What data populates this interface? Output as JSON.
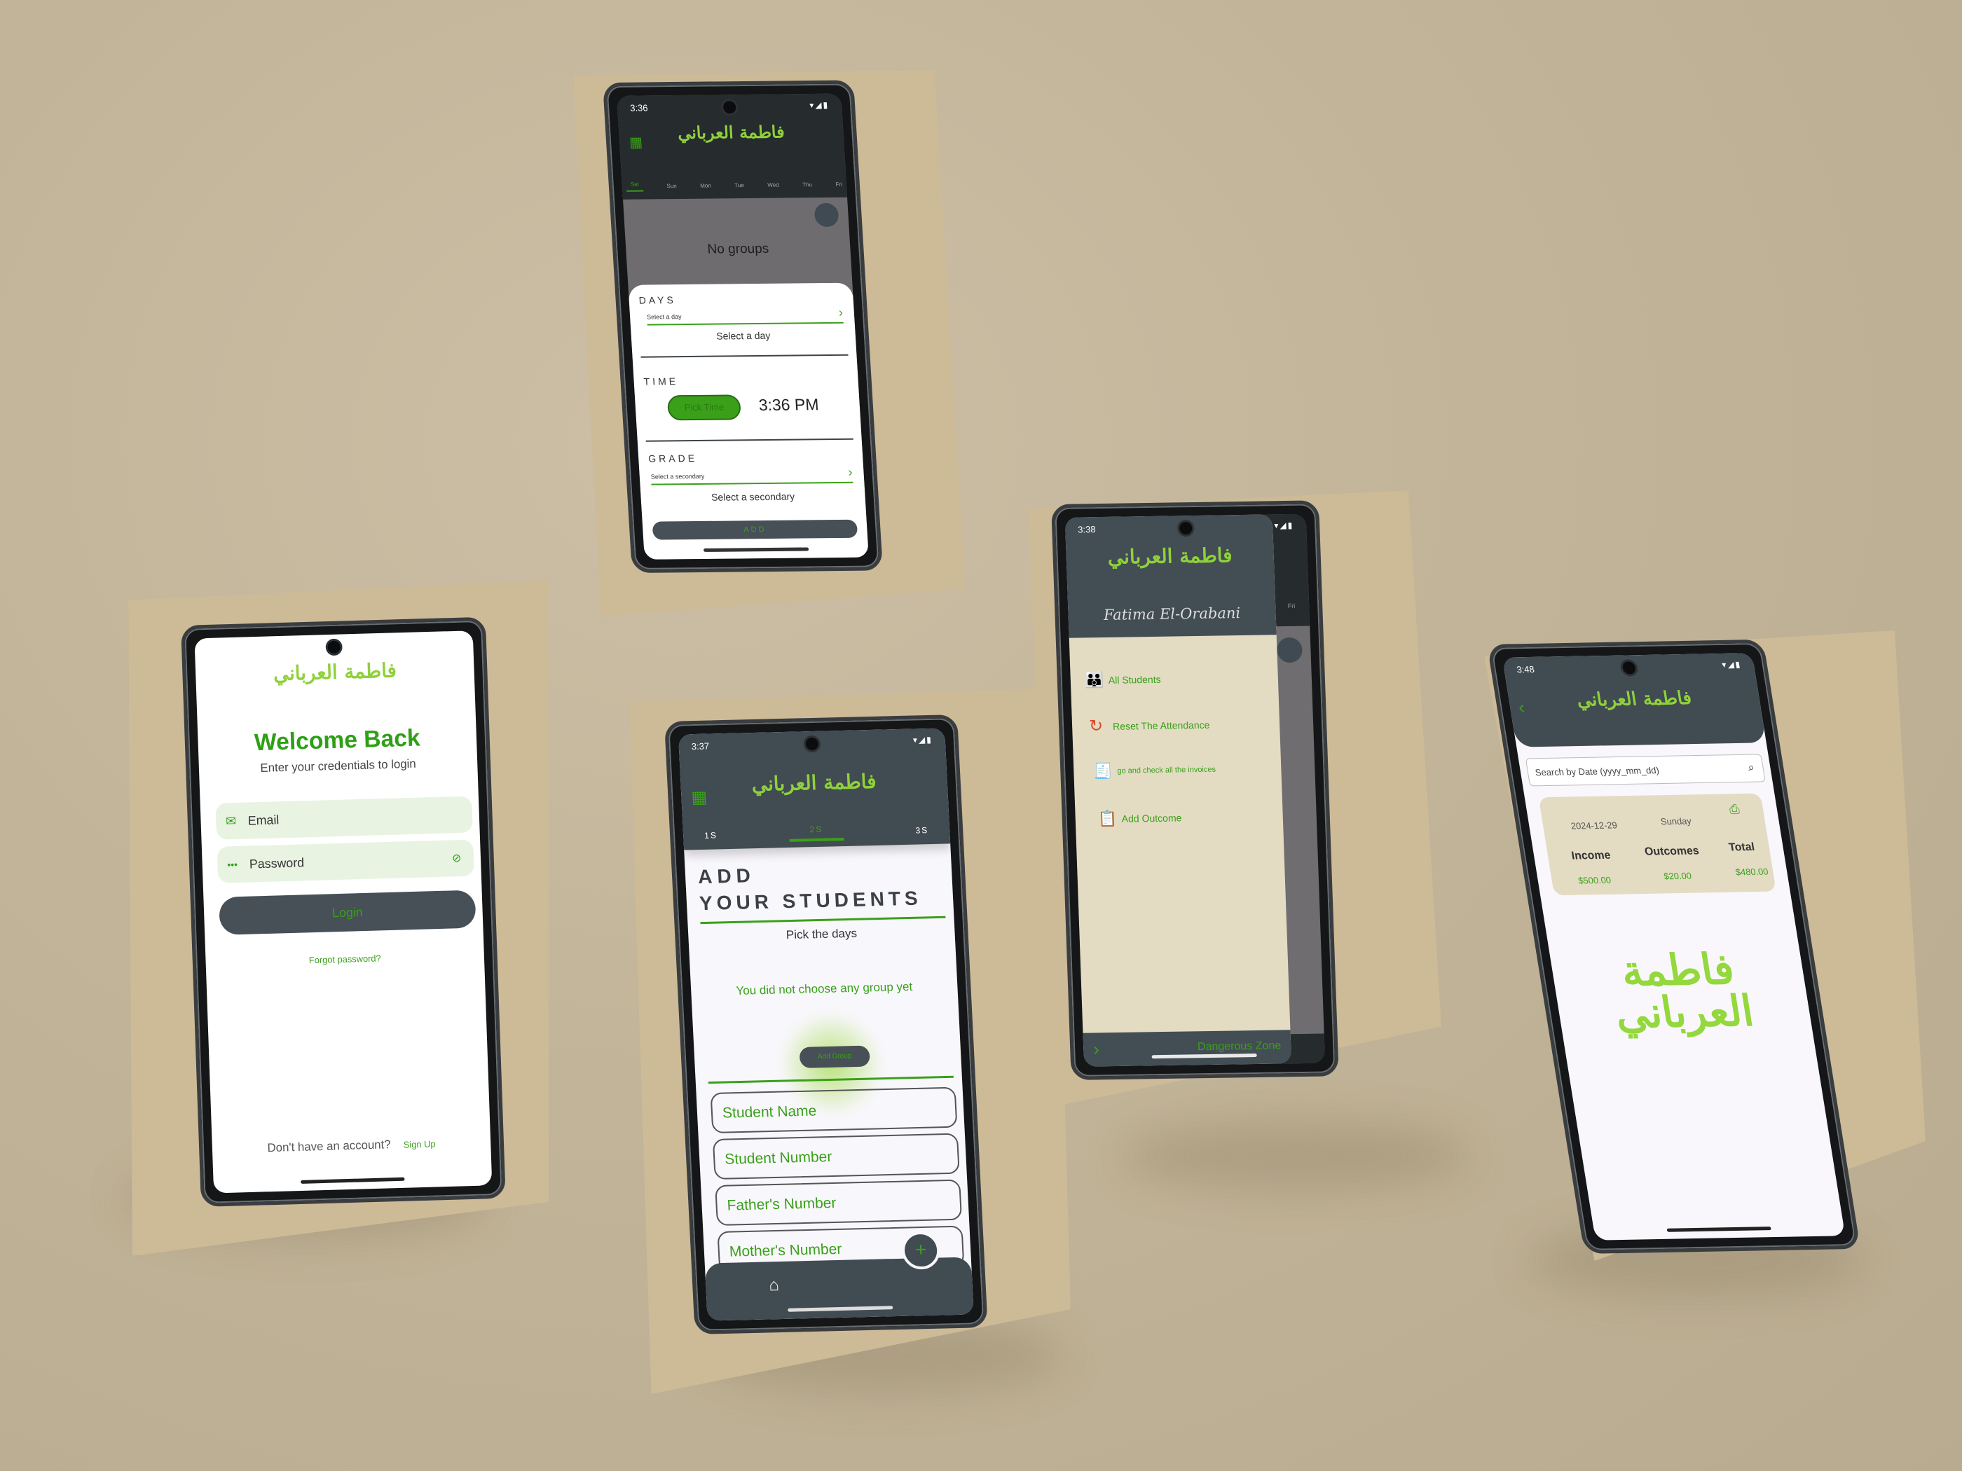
{
  "brand": {
    "logo_text": "فاطمة العرباني",
    "accent": "#3aa01a",
    "dark": "#414b54",
    "light_green": "#8fd13a"
  },
  "login": {
    "title": "Welcome Back",
    "subtitle": "Enter your credentials to login",
    "email_placeholder": "Email",
    "password_placeholder": "Password",
    "login_button": "Login",
    "forgot": "Forgot password?",
    "no_account": "Don't have an account?",
    "signup": "Sign Up"
  },
  "schedule": {
    "status_time": "3:36",
    "day_tabs": [
      "Sat",
      "Sun",
      "Mon",
      "Tue",
      "Wed",
      "Thu",
      "Fri"
    ],
    "empty": "No groups",
    "days_label": "DAYS",
    "days_hint": "Select a day",
    "days_value": "Select a day",
    "time_label": "TIME",
    "pick_time": "Pick Time",
    "time_value": "3:36 PM",
    "grade_label": "GRADE",
    "grade_hint": "Select a secondary",
    "grade_value": "Select a secondary",
    "add_button": "ADD"
  },
  "students": {
    "status_time": "3:37",
    "tabs": [
      "1S",
      "2S",
      "3S"
    ],
    "heading_line1": "ADD",
    "heading_line2": "YOUR STUDENTS",
    "pick_days": "Pick the days",
    "no_group": "You did not choose any group yet",
    "add_group": "Add Group",
    "fields": [
      "Student Name",
      "Student Number",
      "Father's Number",
      "Mother's Number"
    ]
  },
  "drawer": {
    "status_time": "3:38",
    "name": "Fatima El-Orabani",
    "items": [
      {
        "label": "All Students",
        "icon": "people-icon"
      },
      {
        "label": "Reset The Attendance",
        "icon": "reset-icon"
      },
      {
        "label": "go and check all the invoices",
        "icon": "invoice-icon"
      },
      {
        "label": "Add Outcome",
        "icon": "clipboard-icon"
      }
    ],
    "danger": "Dangerous Zone",
    "behind_tab": "Fri"
  },
  "finance": {
    "status_time": "3:48",
    "search_placeholder": "Search by Date (yyyy_mm_dd)",
    "date": "2024-12-29",
    "day": "Sunday",
    "income_label": "Income",
    "outcomes_label": "Outcomes",
    "total_label": "Total",
    "income": "$500.00",
    "outcomes": "$20.00",
    "total": "$480.00"
  }
}
